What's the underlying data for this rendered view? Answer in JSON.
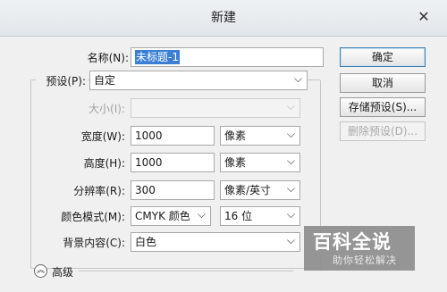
{
  "window": {
    "title": "新建",
    "close_glyph": "✕"
  },
  "form": {
    "name_label": "名称(N):",
    "name_value": "未标题-1",
    "preset_label": "预设(P):",
    "preset_value": "自定",
    "size_label": "大小(I):",
    "size_value": "",
    "width_label": "宽度(W):",
    "width_value": "1000",
    "width_unit": "像素",
    "height_label": "高度(H):",
    "height_value": "1000",
    "height_unit": "像素",
    "resolution_label": "分辨率(R):",
    "resolution_value": "300",
    "resolution_unit": "像素/英寸",
    "color_mode_label": "颜色模式(M):",
    "color_mode_value": "CMYK 颜色",
    "bit_depth_value": "16 位",
    "background_label": "背景内容(C):",
    "background_value": "白色",
    "advanced_label": "高级"
  },
  "buttons": {
    "ok": "确定",
    "cancel": "取消",
    "save_preset": "存储预设(S)...",
    "delete_preset": "删除预设(D)..."
  },
  "watermark": {
    "title": "百科全说",
    "subtitle": "助你轻松解决"
  },
  "colors": {
    "selection": "#3a7fd5",
    "accent_border": "#3c7fb1",
    "watermark": "#8d8d8d"
  }
}
